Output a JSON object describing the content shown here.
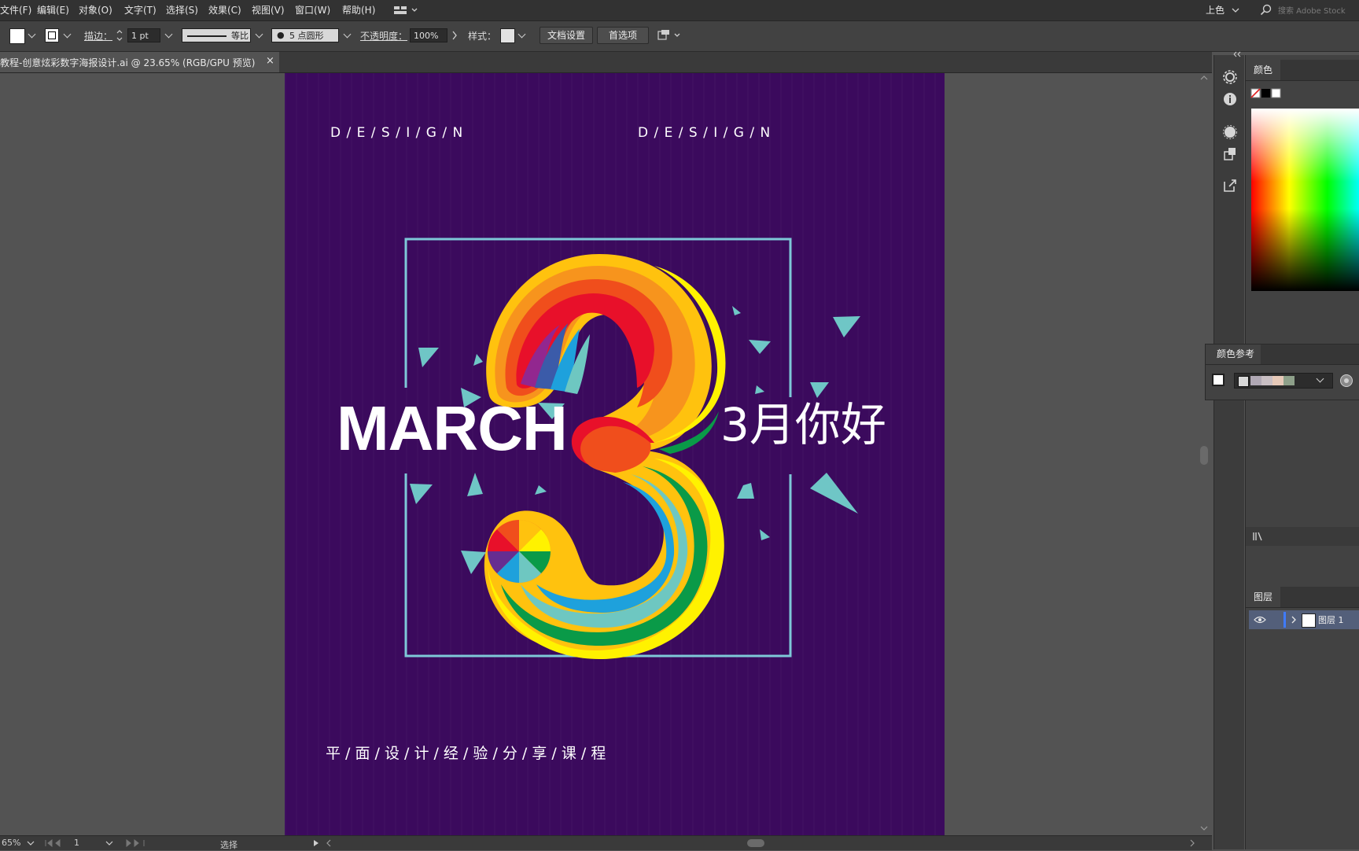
{
  "menubar": {
    "items": [
      "文件(F)",
      "编辑(E)",
      "对象(O)",
      "文字(T)",
      "选择(S)",
      "效果(C)",
      "视图(V)",
      "窗口(W)",
      "帮助(H)"
    ],
    "workspace": "上色",
    "search_placeholder": "搜索 Adobe Stock"
  },
  "controlbar": {
    "stroke_label": "描边：",
    "stroke_weight": "1 pt",
    "stroke_profile": "等比",
    "brush": "5 点圆形",
    "opacity_label": "不透明度：",
    "opacity_value": "100%",
    "style_label": "样式：",
    "doc_setup_button": "文档设置",
    "preferences_button": "首选项",
    "fill_color": "#ffffff"
  },
  "tab": {
    "title": "教程-创意炫彩数字海报设计.ai @ 23.65% (RGB/GPU 预览)",
    "close": "×"
  },
  "artboard": {
    "background": "#3b0a5d",
    "design_left": "D / E / S / I / G / N",
    "design_right": "D / E / S / I / G / N",
    "march": "MARCH",
    "greeting": "3月你好",
    "subtitle": "平 / 面 / 设 / 计 / 经 / 验 / 分 / 享 / 课 / 程",
    "frame_color": "#7ec8d8",
    "triangle_color": "#6fc6c6",
    "rainbow_colors": [
      "#e8102a",
      "#f04e1c",
      "#f7941d",
      "#ffc20e",
      "#fff200",
      "#0a9a48",
      "#6ec7c1",
      "#1ea1dc",
      "#3b5ba9",
      "#662d91",
      "#92278f"
    ]
  },
  "panels": {
    "color_tab": "颜色",
    "color_ref_tab": "颜色参考",
    "layers_tab": "图层",
    "layer_name": "图层 1",
    "color_ref_swatches": [
      "#b0a8b4",
      "#c9bfc3",
      "#e6c9b8",
      "#8ea08a"
    ]
  },
  "statusbar": {
    "zoom": "65%",
    "page": "1",
    "tool": "选择"
  }
}
